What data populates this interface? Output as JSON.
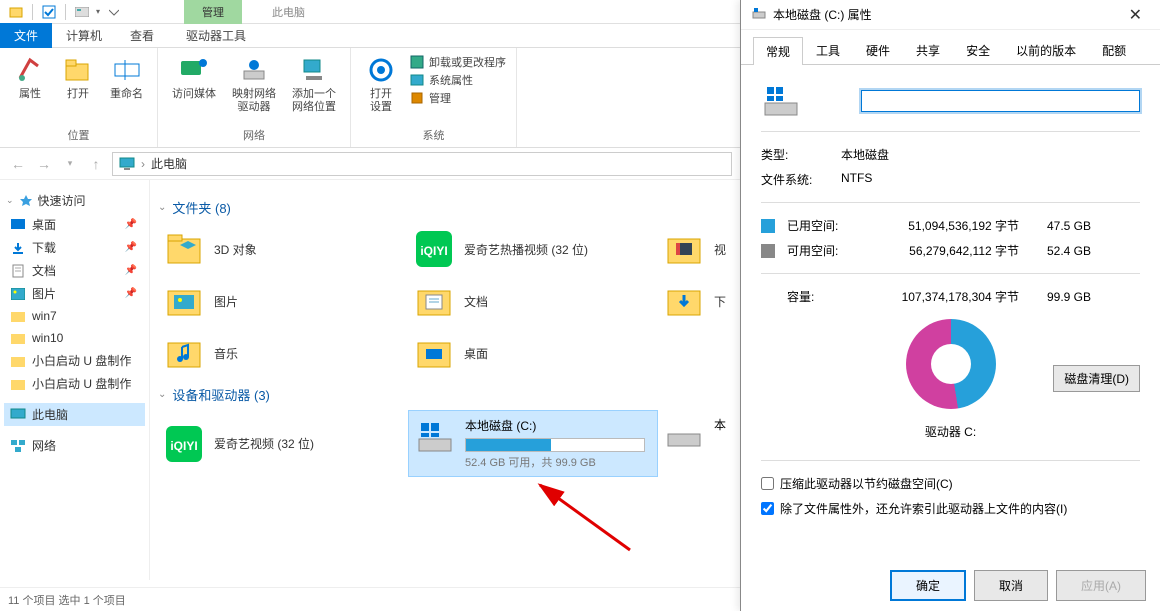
{
  "titlebar": {
    "context_tab": "管理",
    "context_sub": "此电脑"
  },
  "ribbon_tabs": {
    "file": "文件",
    "computer": "计算机",
    "view": "查看",
    "drive_tools": "驱动器工具"
  },
  "ribbon": {
    "group_location": "位置",
    "group_network": "网络",
    "group_system": "系统",
    "properties": "属性",
    "open": "打开",
    "rename": "重命名",
    "access_media": "访问媒体",
    "map_drive": "映射网络\n驱动器",
    "add_network": "添加一个\n网络位置",
    "open_settings": "打开\n设置",
    "uninstall": "卸载或更改程序",
    "sys_props": "系统属性",
    "manage": "管理"
  },
  "nav": {
    "location": "此电脑"
  },
  "sidebar": {
    "quick_access": "快速访问",
    "items": [
      {
        "label": "桌面",
        "icon": "desktop"
      },
      {
        "label": "下载",
        "icon": "download"
      },
      {
        "label": "文档",
        "icon": "document"
      },
      {
        "label": "图片",
        "icon": "picture"
      },
      {
        "label": "win7",
        "icon": "folder"
      },
      {
        "label": "win10",
        "icon": "folder"
      },
      {
        "label": "小白启动 U 盘制作",
        "icon": "folder"
      },
      {
        "label": "小白启动 U 盘制作",
        "icon": "folder"
      }
    ],
    "this_pc": "此电脑",
    "network": "网络"
  },
  "content": {
    "group_folders": "文件夹 (8)",
    "group_devices": "设备和驱动器 (3)",
    "folders": [
      {
        "label": "3D 对象",
        "icon": "3d"
      },
      {
        "label": "爱奇艺热播视频 (32 位)",
        "icon": "iqiyi"
      },
      {
        "label": "视",
        "icon": "video"
      },
      {
        "label": "图片",
        "icon": "picture"
      },
      {
        "label": "文档",
        "icon": "document"
      },
      {
        "label": "下",
        "icon": "download"
      },
      {
        "label": "音乐",
        "icon": "music"
      },
      {
        "label": "桌面",
        "icon": "desktop"
      }
    ],
    "drives": [
      {
        "label": "爱奇艺视频 (32 位)",
        "icon": "iqiyi",
        "type": "app"
      },
      {
        "label": "本地磁盘 (C:)",
        "sub": "52.4 GB 可用，共 99.9 GB",
        "fill_pct": 48,
        "selected": true,
        "type": "drive"
      },
      {
        "label": "本",
        "type": "drive-partial"
      }
    ]
  },
  "statusbar": {
    "text": "11 个项目    选中 1 个项目"
  },
  "dialog": {
    "title": "本地磁盘 (C:) 属性",
    "tabs": [
      "常规",
      "工具",
      "硬件",
      "共享",
      "安全",
      "以前的版本",
      "配额"
    ],
    "active_tab": "常规",
    "type_label": "类型:",
    "type_val": "本地磁盘",
    "fs_label": "文件系统:",
    "fs_val": "NTFS",
    "used_label": "已用空间:",
    "used_bytes": "51,094,536,192 字节",
    "used_gb": "47.5 GB",
    "free_label": "可用空间:",
    "free_bytes": "56,279,642,112 字节",
    "free_gb": "52.4 GB",
    "capacity_label": "容量:",
    "capacity_bytes": "107,374,178,304 字节",
    "capacity_gb": "99.9 GB",
    "drive_label": "驱动器 C:",
    "disk_cleanup": "磁盘清理(D)",
    "compress_label": "压缩此驱动器以节约磁盘空间(C)",
    "index_label": "除了文件属性外，还允许索引此驱动器上文件的内容(I)",
    "ok": "确定",
    "cancel": "取消",
    "apply": "应用(A)",
    "colors": {
      "used": "#26a0da",
      "free": "#888888"
    }
  }
}
